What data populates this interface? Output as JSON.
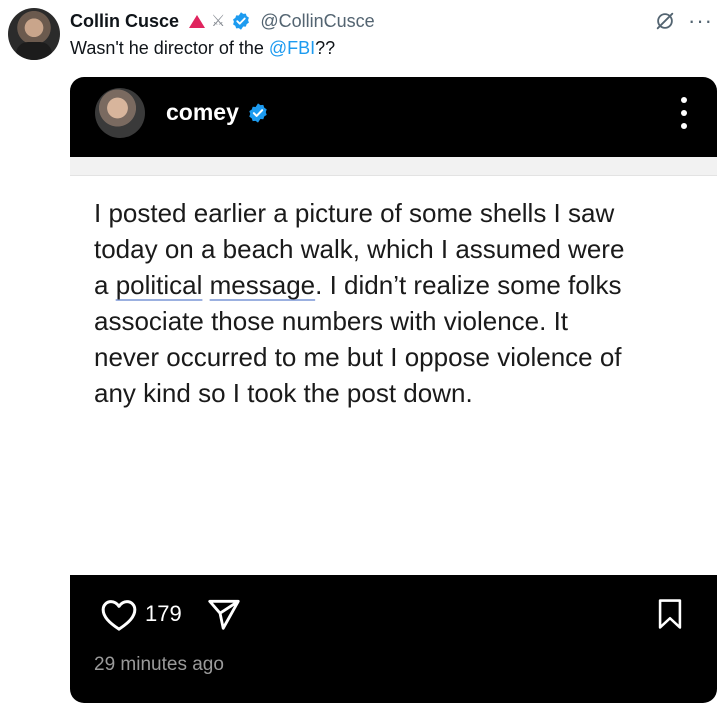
{
  "tweet": {
    "author_name": "Collin Cusce",
    "handle": "@CollinCusce",
    "text_prefix": "Wasn't he director of the ",
    "mention": "@FBI",
    "text_suffix": "??",
    "badges": [
      "red-triangle-icon",
      "crossed-swords-icon",
      "verified-icon"
    ],
    "accent_color": "#1d9bf0"
  },
  "embedded_post": {
    "username": "comey",
    "verified": true,
    "body_line1": "I posted earlier a picture of some shells I saw",
    "body_line2": "today on a beach walk, which I assumed were",
    "body_line3_a": "a ",
    "body_line3_political": "political",
    "body_line3_b": " ",
    "body_line3_message": "message",
    "body_line3_c": ". I didn’t realize some folks",
    "body_line4": "associate those numbers with violence. It",
    "body_line5": "never occurred to me but I oppose violence of",
    "body_line6": "any kind so I took the post down.",
    "likes": "179",
    "timestamp": "29 minutes ago"
  }
}
